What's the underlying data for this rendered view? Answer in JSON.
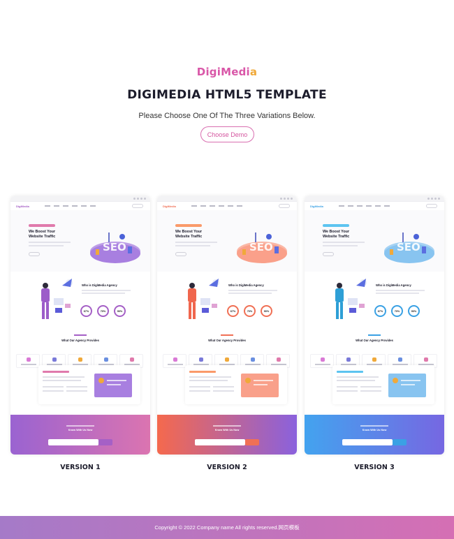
{
  "header": {
    "logo_part1": "DigiMedi",
    "logo_part2": "a",
    "title": "DIGIMEDIA HTML5 TEMPLATE",
    "subtitle": "Please Choose One Of The Three Variations Below.",
    "choose_button": "Choose Demo"
  },
  "demos": [
    {
      "label": "VERSION 1",
      "logo_text": "DigiMedia",
      "hero_title": "We Boost Your Website Traffic",
      "about_title": "Who is DigiMedia Agency",
      "stats": [
        "67%",
        "70%",
        "90%"
      ],
      "services_title": "What Our Agency Provides",
      "subscribe_text": "Know With Us Now",
      "accent": "#a560c6",
      "accent2": "#e07aac",
      "hero_color": "#a87fe0",
      "person_shirt": "#9c5dc9",
      "gradient": "linear-gradient(90deg,#9a63d1,#db74b0)"
    },
    {
      "label": "VERSION 2",
      "logo_text": "DigiMedia",
      "hero_title": "We Boost Your Website Traffic",
      "about_title": "Who is DigiMedia Agency",
      "stats": [
        "67%",
        "70%",
        "90%"
      ],
      "services_title": "What Our Agency Provides",
      "subscribe_text": "Know With Us Now",
      "accent": "#f07055",
      "accent2": "#fa9a6a",
      "hero_color": "#f9a08a",
      "person_shirt": "#f0664d",
      "gradient": "linear-gradient(90deg,#f5694d,#8a61dd)"
    },
    {
      "label": "VERSION 3",
      "logo_text": "DigiMedia",
      "hero_title": "We Boost Your Website Traffic",
      "about_title": "Who is DigiMedia Agency",
      "stats": [
        "67%",
        "70%",
        "90%"
      ],
      "services_title": "What Our Agency Provides",
      "subscribe_text": "Know With Us Now",
      "accent": "#3aa1e4",
      "accent2": "#5dc4f0",
      "hero_color": "#88c4f0",
      "person_shirt": "#2e9fd6",
      "gradient": "linear-gradient(90deg,#43a3ef,#7667e2)"
    }
  ],
  "footer": {
    "copyright": "Copyright © 2022 Company name All rights reserved.网页模板",
    "gradient": "linear-gradient(90deg,#a57ac8,#d56fb4)"
  }
}
